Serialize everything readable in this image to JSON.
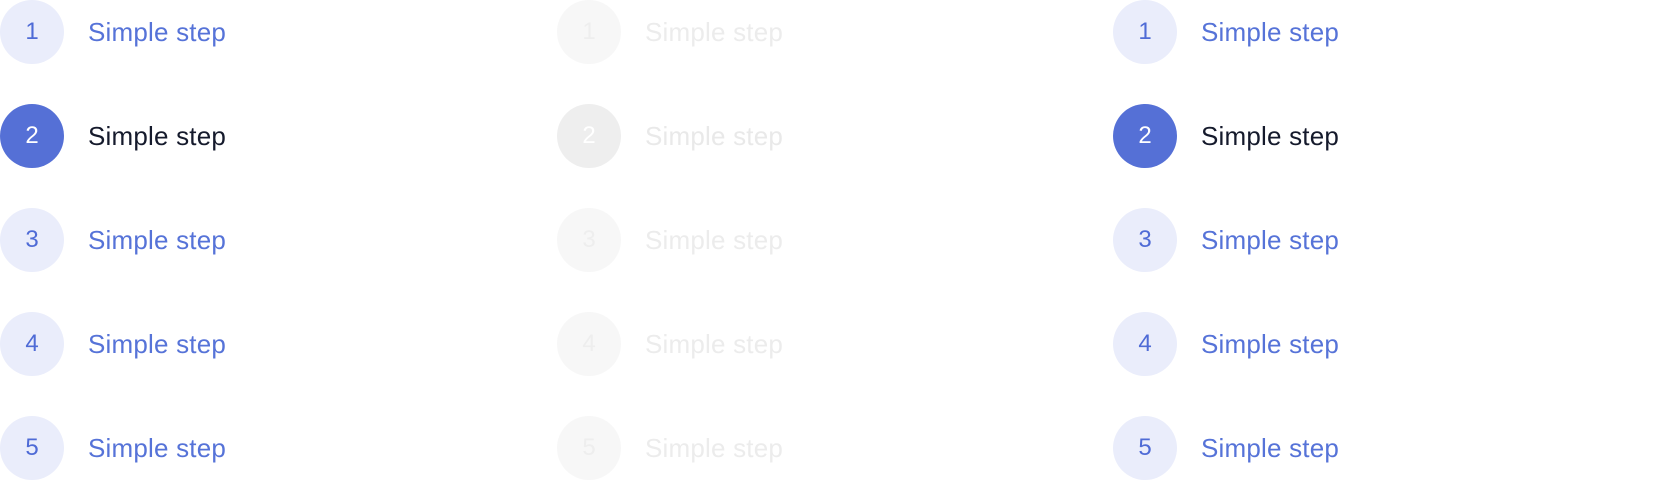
{
  "steppers": [
    {
      "variant": "enabled",
      "active_step": 2,
      "steps": [
        {
          "number": "1",
          "label": "Simple step"
        },
        {
          "number": "2",
          "label": "Simple step"
        },
        {
          "number": "3",
          "label": "Simple step"
        },
        {
          "number": "4",
          "label": "Simple step"
        },
        {
          "number": "5",
          "label": "Simple step"
        }
      ]
    },
    {
      "variant": "disabled",
      "active_step": 2,
      "steps": [
        {
          "number": "1",
          "label": "Simple step"
        },
        {
          "number": "2",
          "label": "Simple step"
        },
        {
          "number": "3",
          "label": "Simple step"
        },
        {
          "number": "4",
          "label": "Simple step"
        },
        {
          "number": "5",
          "label": "Simple step"
        }
      ]
    },
    {
      "variant": "enabled",
      "active_step": 2,
      "steps": [
        {
          "number": "1",
          "label": "Simple step"
        },
        {
          "number": "2",
          "label": "Simple step"
        },
        {
          "number": "3",
          "label": "Simple step"
        },
        {
          "number": "4",
          "label": "Simple step"
        },
        {
          "number": "5",
          "label": "Simple step"
        }
      ]
    }
  ],
  "colors": {
    "accent": "#5570d6",
    "accent_light": "#eaedfb",
    "active_text": "#151a2c",
    "disabled_circle": "#f7f7f7",
    "disabled_text": "#ececec"
  }
}
